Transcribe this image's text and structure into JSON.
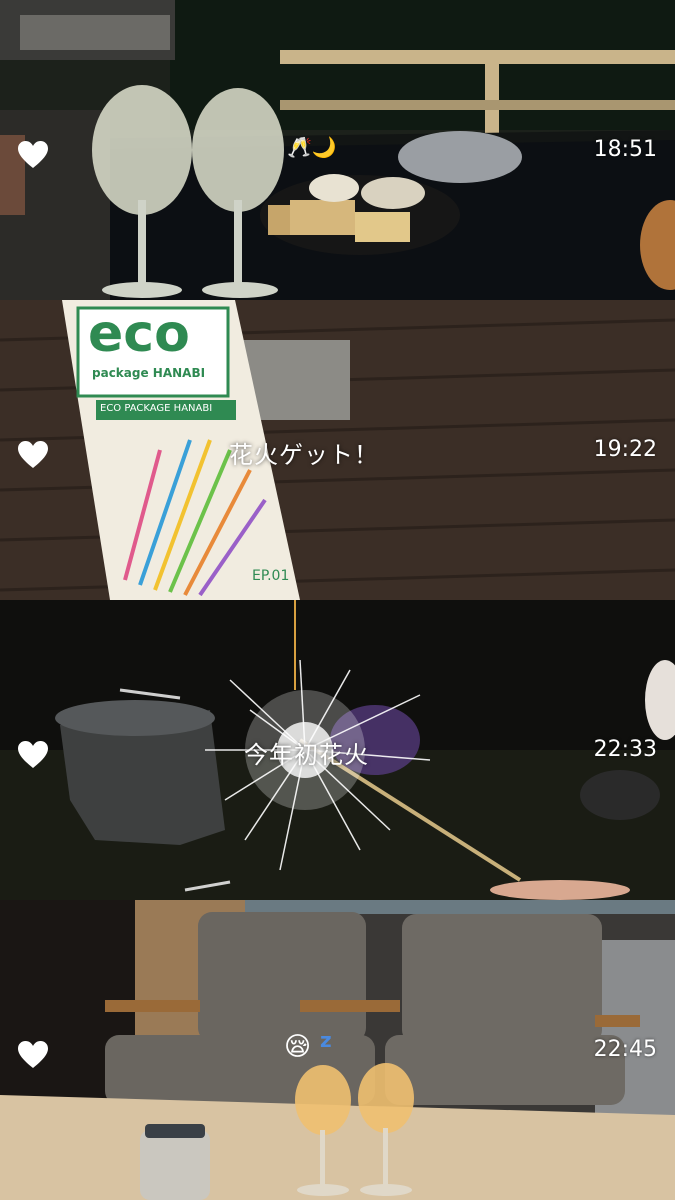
{
  "frames": [
    {
      "time": "18:51",
      "caption": "",
      "sticker": "toast-glasses-and-moon"
    },
    {
      "time": "19:22",
      "caption": "花火ゲット！",
      "package_brand": "eco",
      "package_line1": "package HANABI",
      "package_line2": "ECO PACKAGE HANABI",
      "package_ep": "EP.01"
    },
    {
      "time": "22:33",
      "caption": "今年初花火"
    },
    {
      "time": "22:45",
      "caption": "",
      "sticker": "sleepy-face-zzz"
    }
  ],
  "colors": {
    "heart": "#ffffff",
    "text": "#ffffff"
  }
}
